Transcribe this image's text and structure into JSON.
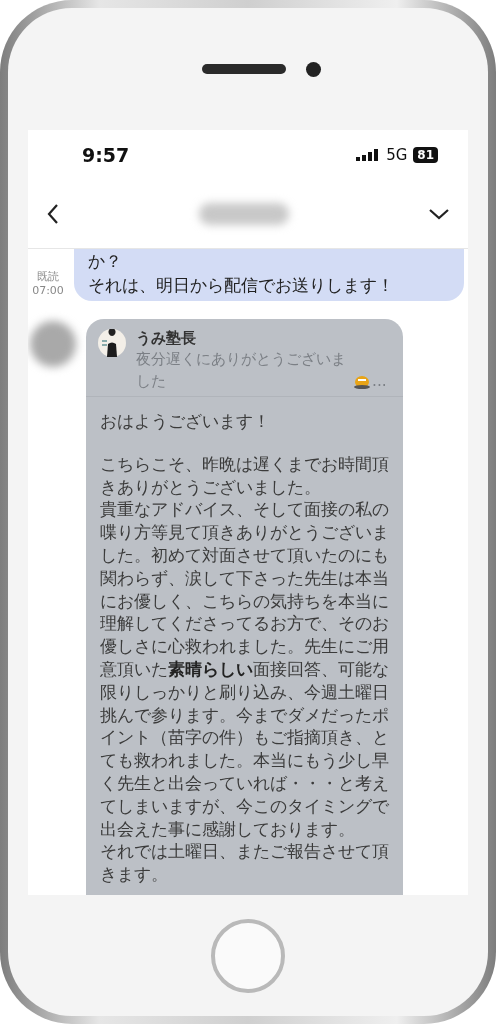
{
  "status_bar": {
    "time": "9:57",
    "network": "5G",
    "battery": "81"
  },
  "messages": [
    {
      "kind": "sent",
      "paragraphs": [
        "か？",
        "それは、明日から配信でお送りします！"
      ],
      "read_label": "既読",
      "time": "07:00"
    },
    {
      "kind": "received",
      "reply": {
        "name": "うみ塾長",
        "text": "夜分遅くにありがとうございました",
        "ellipsis": "..."
      },
      "blocks": [
        [
          "おはようございます！"
        ],
        [
          "こちらこそ、昨晩は遅くまでお時間頂きありがとうございました。",
          "貴重なアドバイス、そして面接の私の喋り方等見て頂きありがとうございました。初めて対面させて頂いたのにも関わらず、涙して下さった先生は本当にお優しく、こちらの気持ちを本当に理解してくださってるお方で、そのお優しさに心救われました。先生にご用意頂いた**素晴らしい**面接回答、可能な限りしっかりと刷り込み、今週土曜日挑んで参ります。今までダメだったポイント（苗字の件）もご指摘頂き、とても救われました。本当にもう少し早く先生と出会っていれば・・・と考えてしまいますが、今このタイミングで出会えた事に感謝しております。",
          "それでは土曜日、またご報告させて頂きます。"
        ]
      ]
    }
  ]
}
